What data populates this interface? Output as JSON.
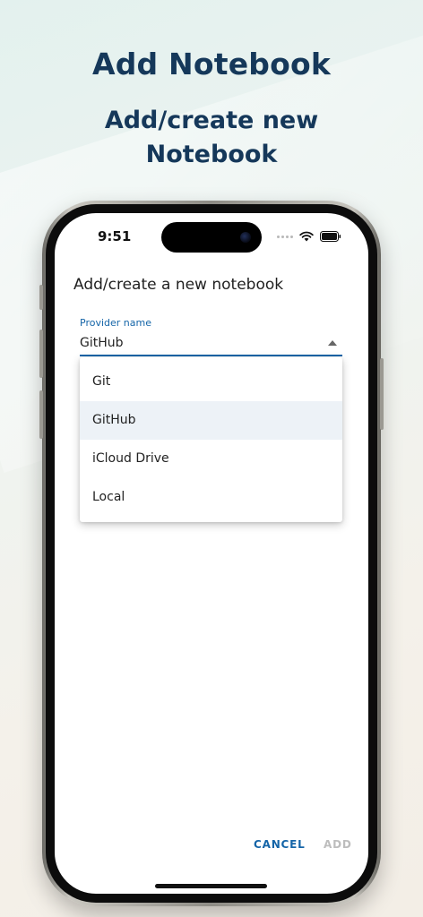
{
  "promo": {
    "title": "Add Notebook",
    "subtitle_line1": "Add/create new",
    "subtitle_line2": "Notebook"
  },
  "status_bar": {
    "time": "9:51",
    "icons": [
      "signal-dots-icon",
      "wifi-icon",
      "battery-icon"
    ]
  },
  "dialog": {
    "title": "Add/create a new notebook",
    "provider_field": {
      "label": "Provider name",
      "value": "GitHub"
    },
    "dropdown": {
      "options": [
        "Git",
        "GitHub",
        "iCloud Drive",
        "Local"
      ],
      "selected": "GitHub"
    },
    "actions": {
      "cancel_label": "CANCEL",
      "add_label": "ADD"
    }
  },
  "colors": {
    "headline": "#15385a",
    "accent": "#1565a8",
    "disabled": "#bdbdbd",
    "selected_bg": "#edf2f7"
  }
}
